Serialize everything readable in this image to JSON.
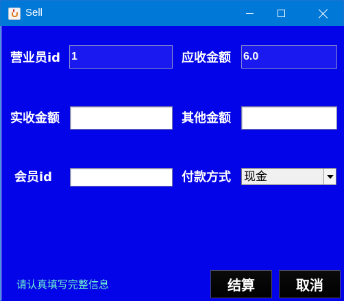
{
  "window": {
    "title": "Sell"
  },
  "form": {
    "salesperson_id_label": "营业员id",
    "salesperson_id_value": "1",
    "receivable_label": "应收金额",
    "receivable_value": "6.0",
    "received_label": "实收金额",
    "received_value": "",
    "other_amount_label": "其他金额",
    "other_amount_value": "",
    "member_id_label": "会员id",
    "member_id_value": "",
    "payment_method_label": "付款方式",
    "payment_method_value": "现金"
  },
  "footer": {
    "hint": "请认真填写完整信息",
    "confirm_label": "结算",
    "cancel_label": "取消"
  },
  "colors": {
    "background": "#0404e8",
    "titlebar": "#0078d7",
    "hint": "#6ff2d0",
    "button": "#000000"
  },
  "icons": {
    "app": "java-icon",
    "minimize": "minimize-icon",
    "maximize": "maximize-icon",
    "close": "close-icon",
    "dropdown": "chevron-down-icon"
  }
}
